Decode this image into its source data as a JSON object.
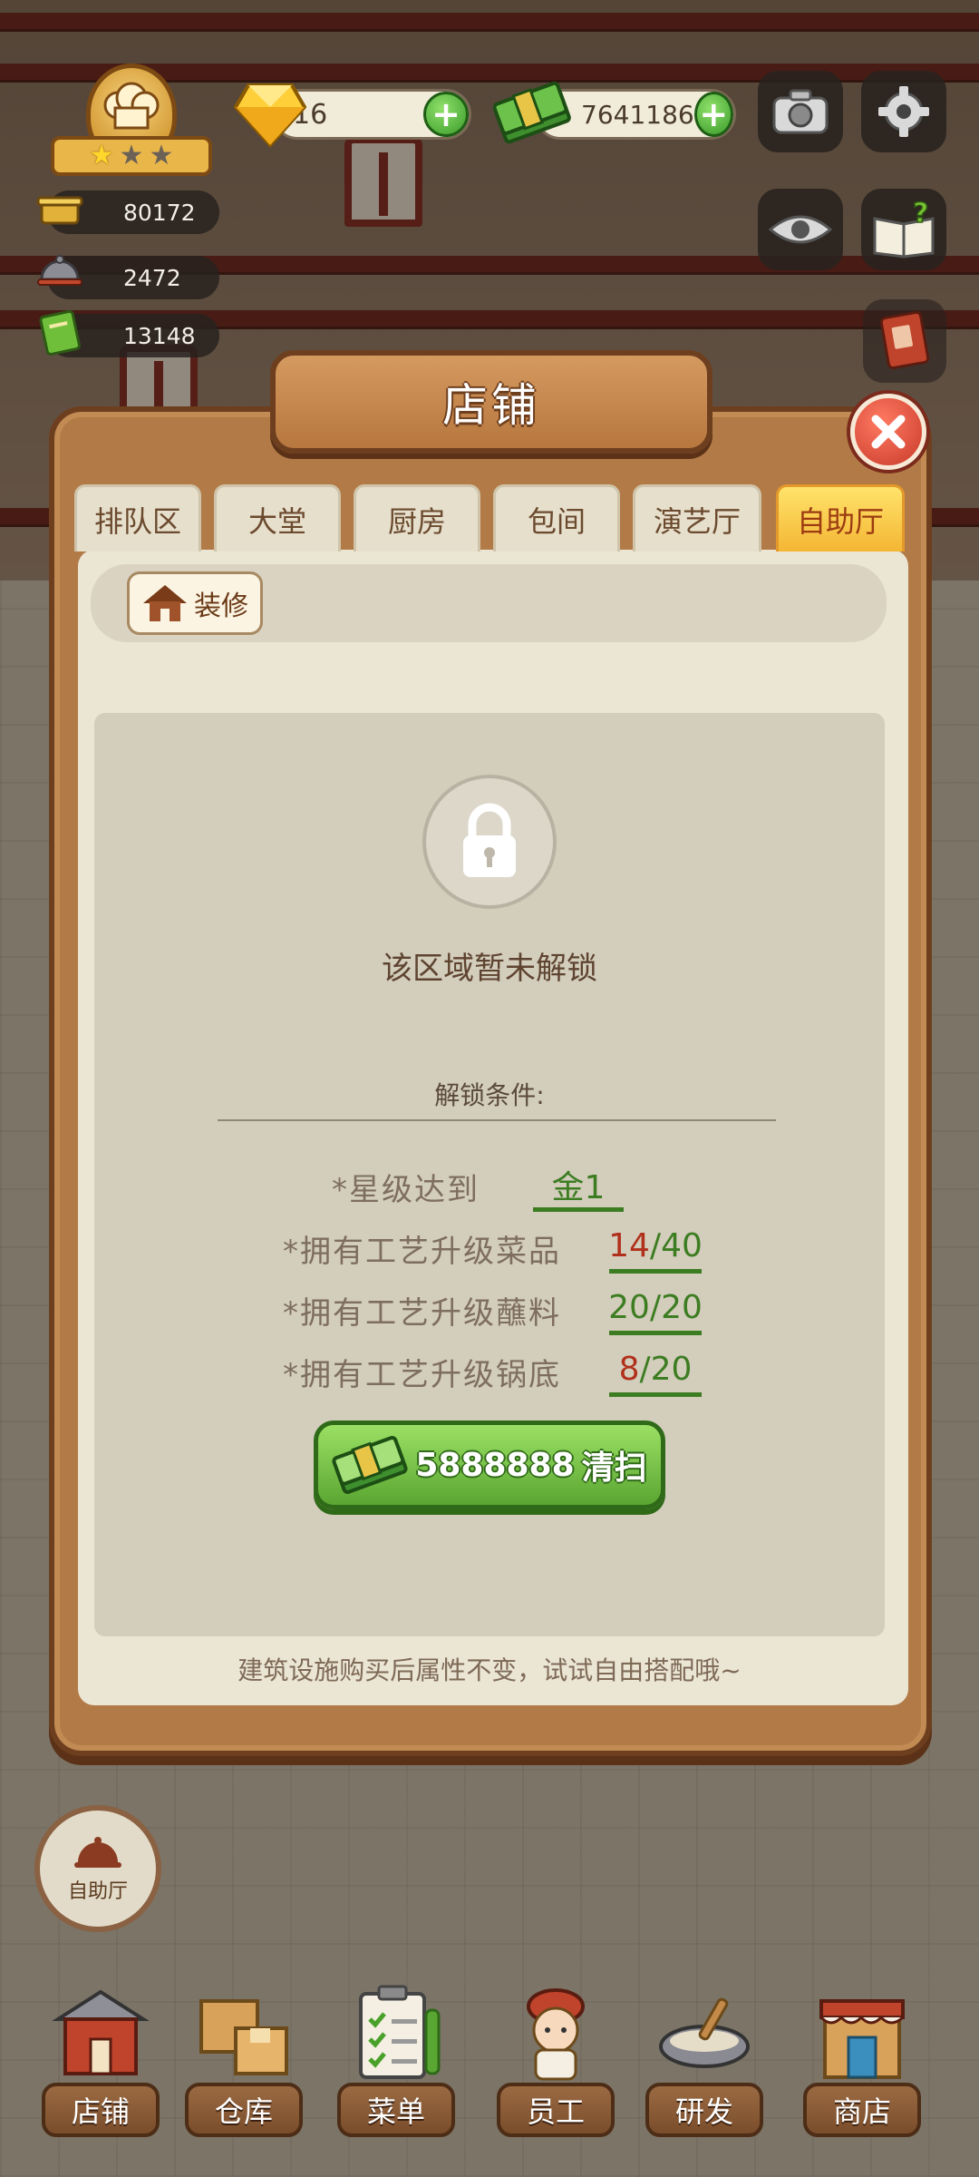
{
  "hud": {
    "gems": "16",
    "cash": "7641186",
    "stats": [
      {
        "icon": "cooking-pot-icon",
        "value": "80172"
      },
      {
        "icon": "serving-cloche-icon",
        "value": "2472"
      },
      {
        "icon": "recipe-book-icon",
        "value": "13148"
      }
    ],
    "stars": {
      "filled": 1,
      "total": 3
    }
  },
  "panel": {
    "title": "店铺",
    "tabs": [
      "排队区",
      "大堂",
      "厨房",
      "包间",
      "演艺厅",
      "自助厅"
    ],
    "active_tab": "自助厅",
    "decorate_label": "装修",
    "locked_text": "该区域暂未解锁",
    "conditions_title": "解锁条件:",
    "conditions": [
      {
        "label": "*星级达到",
        "value": "金1",
        "status": "met"
      },
      {
        "label": "*拥有工艺升级菜品",
        "current": "14",
        "total": "40",
        "status": "unmet"
      },
      {
        "label": "*拥有工艺升级蘸料",
        "current": "20",
        "total": "20",
        "status": "met"
      },
      {
        "label": "*拥有工艺升级锅底",
        "current": "8",
        "total": "20",
        "status": "unmet"
      }
    ],
    "clean_button": {
      "cost": "5888888",
      "label": "清扫"
    },
    "footer_tip": "建筑设施购买后属性不变，试试自由搭配哦~"
  },
  "bottom": {
    "current_area_label": "自助厅",
    "nav": [
      "店铺",
      "仓库",
      "菜单",
      "员工",
      "研发",
      "商店"
    ]
  },
  "colors": {
    "panel_wood": "#b27a46",
    "active_tab": "#f4b634",
    "met_green": "#3d7d22",
    "unmet_red": "#b0301b",
    "clean_button": "#5aa632"
  }
}
